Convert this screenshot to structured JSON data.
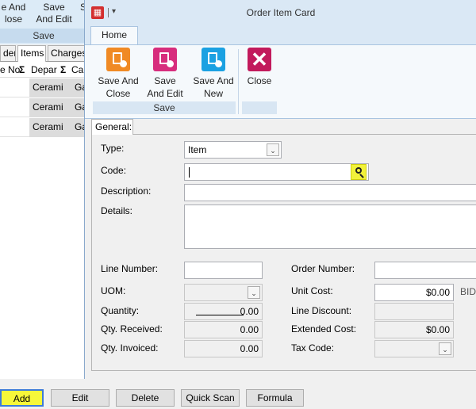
{
  "background_window": {
    "ribbon_partial_1_line1": "e And",
    "ribbon_partial_1_line2": "lose",
    "ribbon_btn_line1": "Save",
    "ribbon_btn_line2": "And Edit",
    "ribbon_partial_2": "S",
    "group_label": "Save",
    "tabs": [
      "der",
      "Items",
      "Charges"
    ],
    "columns": [
      "e No",
      "Depar",
      "Ca"
    ],
    "rows": [
      {
        "dept": "Cerami",
        "cat": "Ga"
      },
      {
        "dept": "Cerami",
        "cat": "Ga"
      },
      {
        "dept": "Cerami",
        "cat": "Ga"
      }
    ]
  },
  "bottom_buttons": {
    "add": "Add",
    "edit": "Edit",
    "delete": "Delete",
    "quick_scan": "Quick Scan",
    "formula": "Formula"
  },
  "dialog": {
    "title": "Order Item Card",
    "qat_arrow": "▾",
    "ribbon_tab": "Home",
    "buttons": {
      "save_and_close_1": "Save And",
      "save_and_close_2": "Close",
      "save_and_edit_1": "Save",
      "save_and_edit_2": "And Edit",
      "save_and_new_1": "Save And",
      "save_and_new_2": "New",
      "close": "Close"
    },
    "group_save": "Save",
    "icons": {
      "save_and_close": "save-close-icon",
      "save_and_edit": "save-edit-icon",
      "save_and_new": "save-new-icon",
      "close": "close-icon"
    },
    "colors": {
      "save_and_close": "#f08a24",
      "save_and_edit": "#d72d7d",
      "save_and_new": "#1ba1e2",
      "close": "#c21a5c",
      "highlight": "#f2f23a"
    }
  },
  "form": {
    "tab": "General:",
    "labels": {
      "type": "Type:",
      "code": "Code:",
      "description": "Description:",
      "details": "Details:",
      "line_number": "Line Number:",
      "order_number": "Order Number:",
      "uom": "UOM:",
      "unit_cost": "Unit Cost:",
      "quantity": "Quantity:",
      "line_discount": "Line Discount:",
      "qty_received": "Qty. Received:",
      "extended_cost": "Extended Cost:",
      "qty_invoiced": "Qty. Invoiced:",
      "tax_code": "Tax Code:"
    },
    "values": {
      "type": "Item",
      "code": "",
      "description": "",
      "details": "",
      "line_number": "",
      "order_number": "",
      "uom": "",
      "unit_cost": "$0.00",
      "unit_cost_suffix": "BID",
      "quantity": "0.00",
      "line_discount": "",
      "qty_received": "0.00",
      "extended_cost": "$0.00",
      "qty_invoiced": "0.00",
      "tax_code": ""
    }
  }
}
